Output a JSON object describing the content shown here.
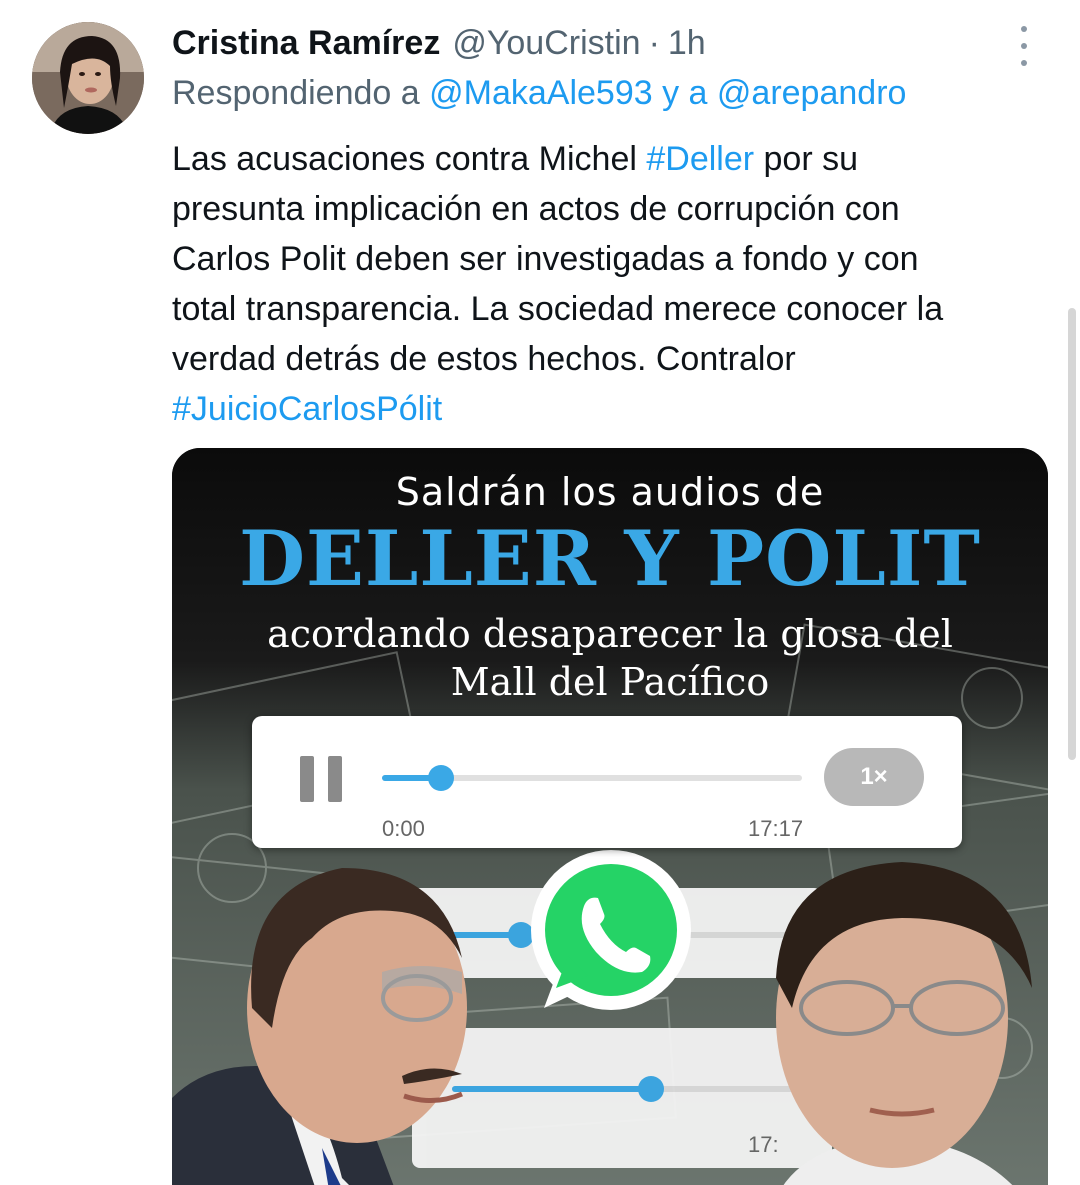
{
  "tweet": {
    "author": {
      "display_name": "Cristina Ramírez",
      "handle": "@YouCristin",
      "separator": "·",
      "time": "1h"
    },
    "reply_prefix": "Respondiendo a",
    "reply_mention_1": "@MakaAle593",
    "reply_connector": "y a",
    "reply_mention_2": "@arepandro",
    "text": {
      "l1_a": "Las acusaciones contra Michel ",
      "l1_hashtag": "#Deller",
      "l1_b": " por su",
      "l2": "presunta implicación en actos de corrupción con",
      "l3": "Carlos Polit deben ser investigadas a fondo y con",
      "l4": "total transparencia. La sociedad merece conocer la",
      "l5": "verdad detrás de estos hechos. Contralor",
      "l6_hashtag": "#JuicioCarlosPólit"
    },
    "media": {
      "headline_1": "Saldrán los audios de",
      "headline_2": "DELLER Y POLIT",
      "headline_3a": "acordando desaparecer la glosa del",
      "headline_3b": "Mall del Pacífico",
      "audio": {
        "progress": 0.14,
        "elapsed": "0:00",
        "duration": "17:17",
        "speed": "1×"
      },
      "bg_audio_time_partial": "17:",
      "bg_audio_time_partial_2": "17",
      "brand_color": "#3aa8e6",
      "whatsapp_color": "#25d366"
    },
    "icons": {
      "more": "more-vertical-icon",
      "pause": "pause-icon",
      "whatsapp": "whatsapp-icon"
    }
  }
}
